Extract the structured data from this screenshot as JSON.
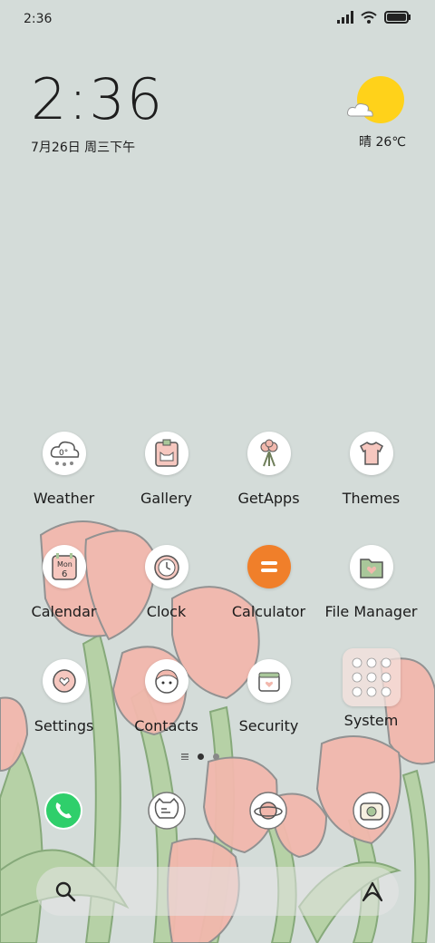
{
  "status_bar": {
    "time": "2:36",
    "icons": [
      "signal-icon",
      "wifi-icon",
      "battery-icon"
    ]
  },
  "clock_widget": {
    "time": "2:36",
    "date": "7月26日 周三下午"
  },
  "weather_widget": {
    "text": "晴 26℃",
    "icon": "sun-cloud-icon"
  },
  "apps": [
    {
      "label": "Weather",
      "icon": "weather-icon"
    },
    {
      "label": "Gallery",
      "icon": "gallery-icon"
    },
    {
      "label": "GetApps",
      "icon": "getapps-icon"
    },
    {
      "label": "Themes",
      "icon": "themes-icon"
    },
    {
      "label": "Calendar",
      "icon": "calendar-icon",
      "badge_top": "Mon",
      "badge_num": "6"
    },
    {
      "label": "Clock",
      "icon": "clock-icon"
    },
    {
      "label": "Calculator",
      "icon": "calculator-icon"
    },
    {
      "label": "File Manager",
      "icon": "file-manager-icon"
    },
    {
      "label": "Settings",
      "icon": "settings-icon"
    },
    {
      "label": "Contacts",
      "icon": "contacts-icon"
    },
    {
      "label": "Security",
      "icon": "security-icon"
    },
    {
      "label": "System",
      "icon": "system-folder-icon"
    }
  ],
  "weather_icon_text": "0°",
  "dock": [
    "phone-icon",
    "messages-icon",
    "browser-icon",
    "camera-icon"
  ],
  "search_bar": {
    "left_icon": "search-icon",
    "right_icon": "assistant-icon"
  },
  "colors": {
    "background": "#d4dcd9",
    "sun": "#ffd21a",
    "tulip": "#f2b8ad",
    "stem": "#a9c79a",
    "phone": "#2fcf6b",
    "calculator": "#f07f2a"
  }
}
